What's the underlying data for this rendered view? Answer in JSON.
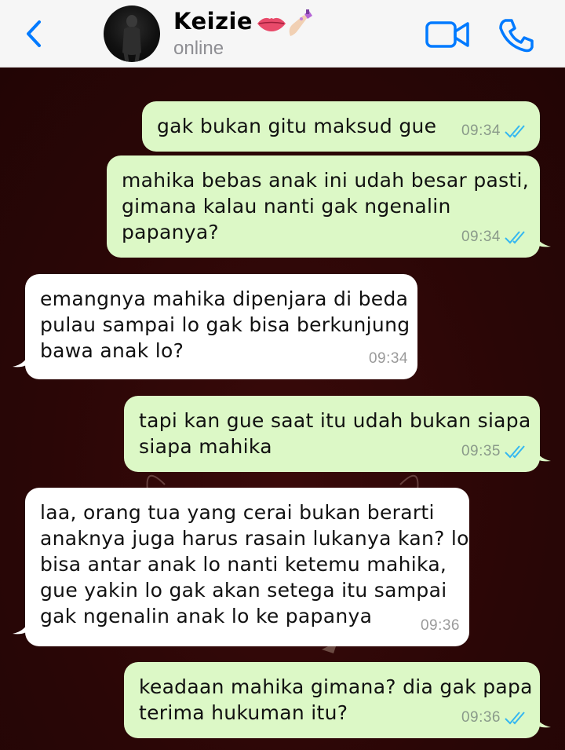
{
  "header": {
    "contact_name": "Keizie",
    "contact_emoji_icons": [
      "lips-icon",
      "nail-polish-icon"
    ],
    "status": "online",
    "accent_color": "#007aff"
  },
  "messages": [
    {
      "direction": "out",
      "text": "gak bukan gitu maksud gue",
      "time": "09:34",
      "read": true
    },
    {
      "direction": "out",
      "text": "mahika bebas anak ini udah besar pasti,\ngimana kalau nanti gak ngenalin\npapanya?",
      "time": "09:34",
      "read": true
    },
    {
      "direction": "in",
      "text": "emangnya mahika dipenjara di beda\npulau sampai lo gak bisa berkunjung\nbawa anak lo?",
      "time": "09:34"
    },
    {
      "direction": "out",
      "text": "tapi kan gue saat itu udah bukan siapa\nsiapa mahika",
      "time": "09:35",
      "read": true
    },
    {
      "direction": "in",
      "text": "laa, orang tua yang cerai bukan berarti\nanaknya juga harus rasain lukanya kan? lo\nbisa antar anak lo nanti ketemu mahika,\ngue yakin lo gak akan setega itu sampai\ngak ngenalin anak lo ke papanya",
      "time": "09:36"
    },
    {
      "direction": "out",
      "text": "keadaan mahika gimana? dia gak papa\nterima hukuman itu?",
      "time": "09:36",
      "read": true
    }
  ],
  "colors": {
    "outgoing_bubble": "#dcf8c6",
    "incoming_bubble": "#ffffff",
    "chat_background": "#2a0606",
    "read_ticks": "#34b7f1"
  }
}
